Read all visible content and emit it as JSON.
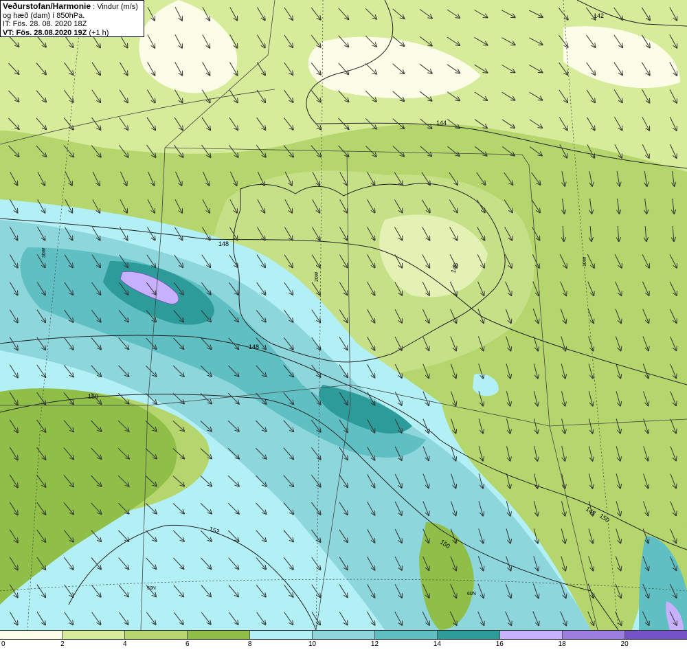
{
  "header": {
    "agency": "Veðurstofan/Harmonie",
    "field": " : Vindur (m/s)",
    "line2": "og hæð (dam) í 850hPa.",
    "line3": "IT: Fös. 28. 08. 2020 18Z",
    "vt_label": "VT: Fös. 28.08.2020 19Z",
    "vt_suffix": " (+1 h)"
  },
  "legend": {
    "colors": [
      "#fbfde6",
      "#d6ec9a",
      "#b4d66c",
      "#8fbf48",
      "#b2f0f6",
      "#8dd6dc",
      "#5fbfc2",
      "#2e9b9b",
      "#c7b1ff",
      "#9b7ee0",
      "#7452c8"
    ],
    "ticks": [
      "0",
      "2",
      "4",
      "6",
      "8",
      "10",
      "12",
      "14",
      "16",
      "18",
      "20"
    ]
  },
  "contour_labels": [
    "142",
    "144",
    "146",
    "148",
    "148",
    "148",
    "150",
    "150",
    "152",
    "150"
  ],
  "graticule_labels": [
    "30W",
    "20W",
    "10W",
    "60N",
    "60N"
  ],
  "wind": {
    "direction_deg": 150,
    "units": "m/s"
  }
}
